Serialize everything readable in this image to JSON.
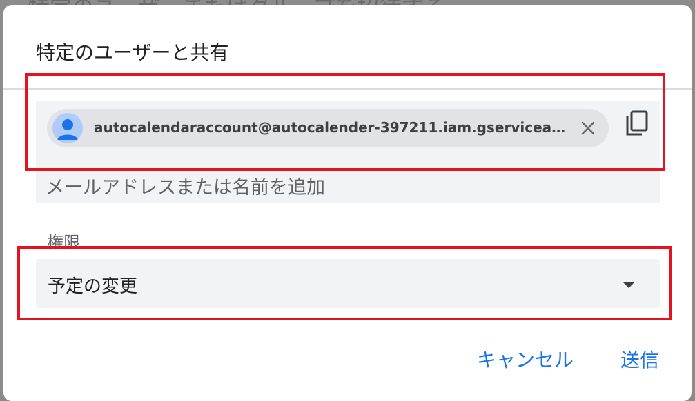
{
  "background": {
    "partial_text": "特定のユーザーまたはグループを招待する"
  },
  "dialog": {
    "title": "特定のユーザーと共有",
    "recipient": {
      "email": "autocalendaraccount@autocalender-397211.iam.gserviceac…",
      "avatar_icon": "person-icon",
      "remove_icon": "close-icon"
    },
    "copy_icon": "copy-icon",
    "input": {
      "placeholder": "メールアドレスまたは名前を追加",
      "value": ""
    },
    "permission": {
      "label": "権限",
      "selected": "予定の変更",
      "caret_icon": "caret-down-icon"
    },
    "buttons": {
      "cancel": "キャンセル",
      "send": "送信"
    }
  },
  "colors": {
    "accent": "#1a73e8",
    "highlight": "#e3141f",
    "field_background": "#f1f3f4",
    "chip_background": "#e1e3e6"
  }
}
